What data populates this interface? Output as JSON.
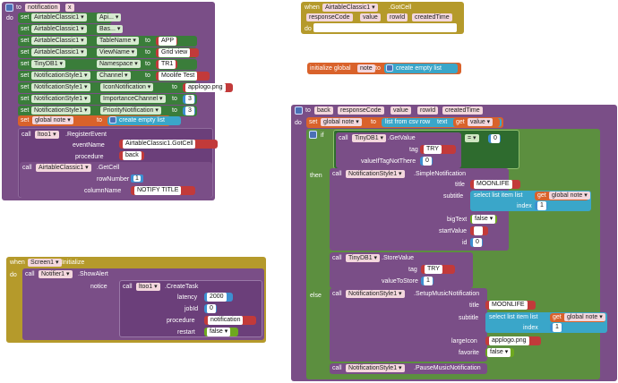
{
  "colors": {
    "procedure": "#7a4e87",
    "event": "#b59a2b",
    "component_set": "#3a7d3a",
    "variable": "#d9622b",
    "text": "#c23a3a",
    "math": "#3d8fd1",
    "logic": "#6ea81f",
    "list": "#3aa6c9"
  },
  "proc_notification": {
    "to": "to",
    "name": "notification",
    "param": "x",
    "do": "do",
    "set": "set",
    "rows": [
      {
        "comp": "AirtableClassic1",
        "prop": "Api...",
        "value": ""
      },
      {
        "comp": "AirtableClassic1",
        "prop": "Bas...",
        "value": ""
      },
      {
        "comp": "AirtableClassic1",
        "prop": "TableName",
        "value": "APP"
      },
      {
        "comp": "AirtableClassic1",
        "prop": "ViewName",
        "value": "Grid view"
      },
      {
        "comp": "TinyDB1",
        "prop": "Namespace",
        "value": "TR1"
      },
      {
        "comp": "NotificationStyle1",
        "prop": "Channel",
        "value": "Moolife Test"
      },
      {
        "comp": "NotificationStyle1",
        "prop": "IconNotification",
        "value": "applogo.png"
      },
      {
        "comp": "NotificationStyle1",
        "prop": "ImportanceChannel",
        "value": "3"
      },
      {
        "comp": "NotificationStyle1",
        "prop": "PriorityNotification",
        "value": "3"
      }
    ],
    "to_kw": "to",
    "setglobal": "global note",
    "setglobal_val": "create empty list",
    "call": "call",
    "lt": "ltoo1",
    "register": ".RegisterEvent",
    "eventName_lbl": "eventName",
    "eventName_val": "AirtableClassic1.GotCell",
    "procedure_lbl": "procedure",
    "procedure_val": "back",
    "getcell_comp": "AirtableClassic1",
    "getcell_method": ".GetCell",
    "rowNumber_lbl": "rowNumber",
    "rowNumber_val": "1",
    "columnName_lbl": "columnName",
    "columnName_val": "NOTIFY TITLE"
  },
  "gotcell": {
    "when": "when",
    "comp": "AirtableClassic1",
    "event": ".GotCell",
    "params": [
      "responseCode",
      "value",
      "rowId",
      "createdTime"
    ],
    "do": "do"
  },
  "initglobal": {
    "label": "initialize global",
    "name": "note",
    "to": "to",
    "value": "create empty list"
  },
  "screen_init": {
    "when": "when",
    "comp": "Screen1",
    "event": ".Initialize",
    "do": "do",
    "call": "call",
    "notifier": "Notifier1",
    "method": ".ShowAlert",
    "notice": "notice",
    "lt": "ltoo1",
    "createtask": ".CreateTask",
    "latency_lbl": "latency",
    "latency_val": "2000",
    "jobId_lbl": "jobId",
    "jobId_val": "0",
    "procedure_lbl": "procedure",
    "procedure_val": "notification",
    "restart_lbl": "restart",
    "restart_val": "false"
  },
  "proc_back": {
    "to": "to",
    "name": "back",
    "params": [
      "responseCode",
      "value",
      "rowId",
      "createdTime"
    ],
    "do": "do",
    "set": "set",
    "setvar": "global note",
    "to_kw": "to",
    "listcsv": "list from csv row",
    "text": "text",
    "get": "get",
    "getvar": "value",
    "if": "if",
    "tinydb": "TinyDB1",
    "getvalue": ".GetValue",
    "eq": "=",
    "eq_num": "0",
    "tag_lbl": "tag",
    "tag_val": "TRY",
    "valueIfTagNotThere_lbl": "valueIfTagNotThere",
    "valueIfTagNotThere_val": "0",
    "then": "then",
    "call": "call",
    "ns": "NotificationStyle1",
    "simple": ".SimpleNotification",
    "title_lbl": "title",
    "title_val": "MOONLIFE",
    "subtitle_lbl": "subtitle",
    "selectlist": "select list item  list",
    "getglobal": "global note",
    "index_lbl": "index",
    "index_val": "1",
    "bigText_lbl": "bigText",
    "bigText_val": "false",
    "startValue_lbl": "startValue",
    "startValue_val": "",
    "id_lbl": "id",
    "id_val": "0",
    "storevalue": ".StoreValue",
    "tag2_val": "TRY",
    "valueToStore_lbl": "valueToStore",
    "valueToStore_val": "1",
    "else": "else",
    "setupmusic": ".SetupMusicNotification",
    "title2_val": "MOONLIFE",
    "index2_val": "1",
    "largeIcon_lbl": "largeIcon",
    "largeIcon_val": "applogo.png",
    "favorite_lbl": "favorite",
    "favorite_val": "false",
    "pausemusic": ".PauseMusicNotification"
  }
}
